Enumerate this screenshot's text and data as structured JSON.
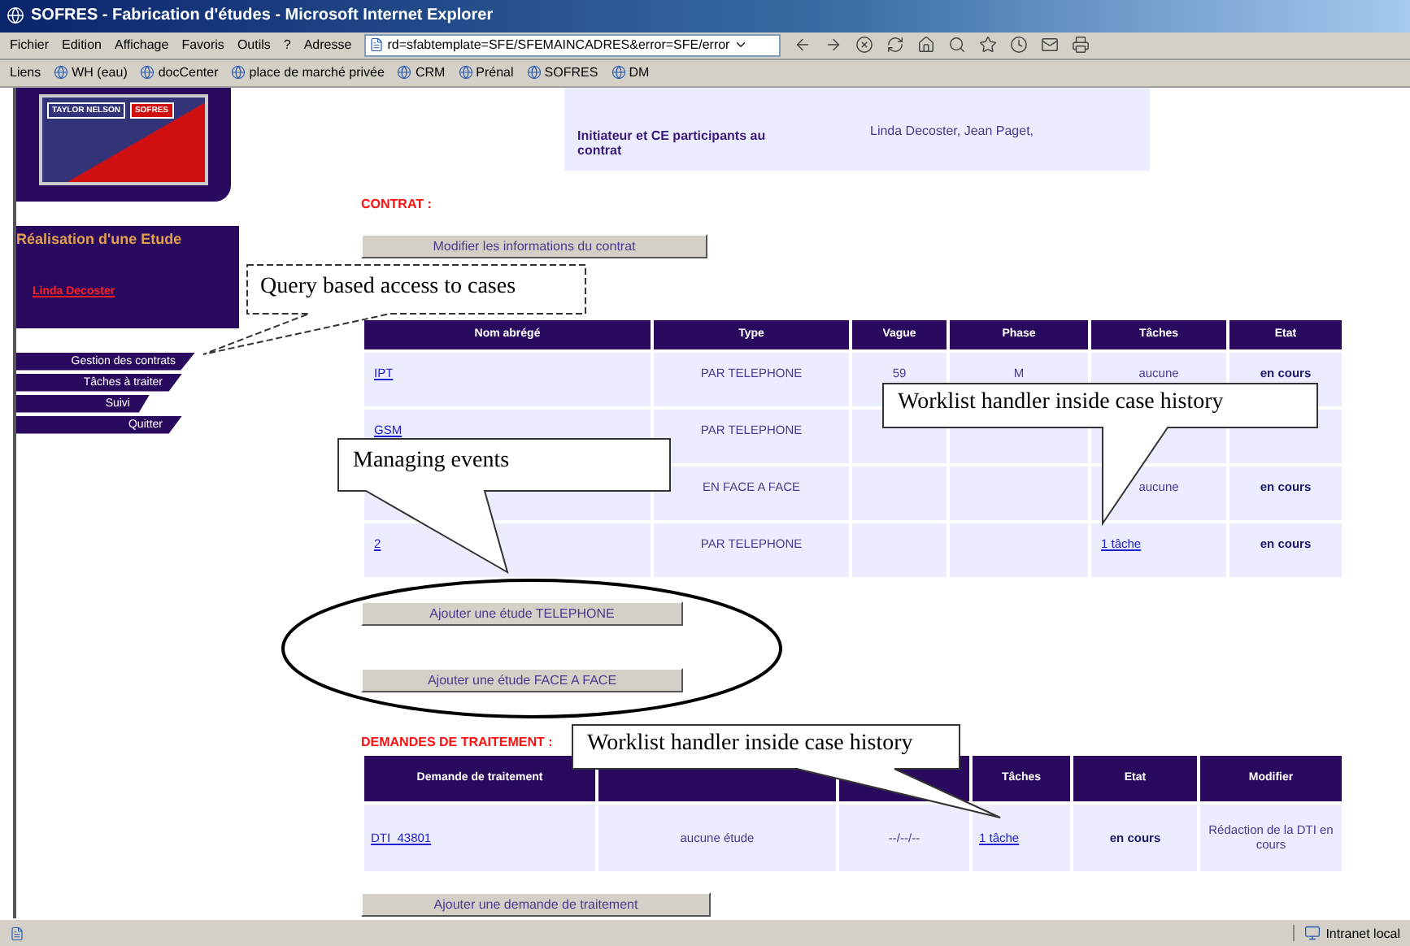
{
  "window": {
    "title": "SOFRES - Fabrication d'études - Microsoft Internet Explorer"
  },
  "menu": [
    "Fichier",
    "Edition",
    "Affichage",
    "Favoris",
    "Outils",
    "?"
  ],
  "address": {
    "label": "Adresse",
    "value": "rd=sfabtemplate=SFE/SFEMAINCADRES&error=SFE/error"
  },
  "links": {
    "label": "Liens",
    "items": [
      "WH (eau)",
      "docCenter",
      "place de marché privée",
      "CRM",
      "Prénal",
      "SOFRES",
      "DM"
    ]
  },
  "sidebar": {
    "logo": [
      "TAYLOR NELSON",
      "SOFRES"
    ],
    "section_title": "Réalisation d'une Etude",
    "user": "Linda Decoster",
    "nav": [
      "Gestion des contrats",
      "Tâches à traiter",
      "Suivi",
      "Quitter"
    ]
  },
  "participants": {
    "label": "Initiateur et CE participants au contrat",
    "value": "Linda Decoster, Jean Paget,"
  },
  "contract": {
    "heading": "CONTRAT :",
    "button": "Modifier les informations du contrat"
  },
  "studies": {
    "columns": [
      {
        "label": "Nom abrégé"
      },
      {
        "label": "Type"
      },
      {
        "label": "Vague"
      },
      {
        "label": "Phase"
      },
      {
        "label": "Tâches"
      },
      {
        "label": "Etat"
      }
    ],
    "rows": [
      [
        {
          "kind": "link",
          "text": "IPT"
        },
        {
          "kind": "text",
          "text": "PAR TELEPHONE"
        },
        {
          "kind": "text",
          "text": "59"
        },
        {
          "kind": "text",
          "text": "M"
        },
        {
          "kind": "text",
          "text": "aucune"
        },
        {
          "kind": "status",
          "text": "en cours"
        }
      ],
      [
        {
          "kind": "link",
          "text": "GSM"
        },
        {
          "kind": "text",
          "text": "PAR TELEPHONE"
        },
        {
          "kind": "empty"
        },
        {
          "kind": "empty"
        },
        {
          "kind": "empty"
        },
        {
          "kind": "empty"
        }
      ],
      [
        {
          "kind": "empty"
        },
        {
          "kind": "text",
          "text": "EN FACE A FACE"
        },
        {
          "kind": "empty"
        },
        {
          "kind": "empty"
        },
        {
          "kind": "text",
          "text": "aucune"
        },
        {
          "kind": "status",
          "text": "en cours"
        }
      ],
      [
        {
          "kind": "link",
          "text": "2"
        },
        {
          "kind": "text",
          "text": "PAR TELEPHONE"
        },
        {
          "kind": "empty"
        },
        {
          "kind": "empty"
        },
        {
          "kind": "link",
          "text": "1 tâche"
        },
        {
          "kind": "status",
          "text": "en cours"
        }
      ]
    ]
  },
  "study_buttons": [
    "Ajouter une étude TELEPHONE",
    "Ajouter une étude FACE A FACE"
  ],
  "requests": {
    "heading": "DEMANDES DE TRAITEMENT :",
    "columns": [
      {
        "label": "Demande de traitement"
      },
      {},
      {},
      {
        "label": "Tâches"
      },
      {
        "label": "Etat"
      },
      {
        "label": "Modifier"
      }
    ],
    "rows": [
      [
        {
          "kind": "link",
          "text": "DTI_43801"
        },
        {
          "kind": "text",
          "text": "aucune étude"
        },
        {
          "kind": "text",
          "text": "--/--/--"
        },
        {
          "kind": "link",
          "text": "1 tâche"
        },
        {
          "kind": "status",
          "text": "en cours"
        },
        {
          "kind": "text",
          "text": "Rédaction de la DTI en cours"
        }
      ]
    ]
  },
  "request_button": "Ajouter une demande de traitement",
  "status_bar": {
    "zone": "Intranet local"
  },
  "callouts": [
    "Query based access to cases",
    "Worklist handler inside case history",
    "Managing events",
    "Worklist handler inside case history"
  ]
}
